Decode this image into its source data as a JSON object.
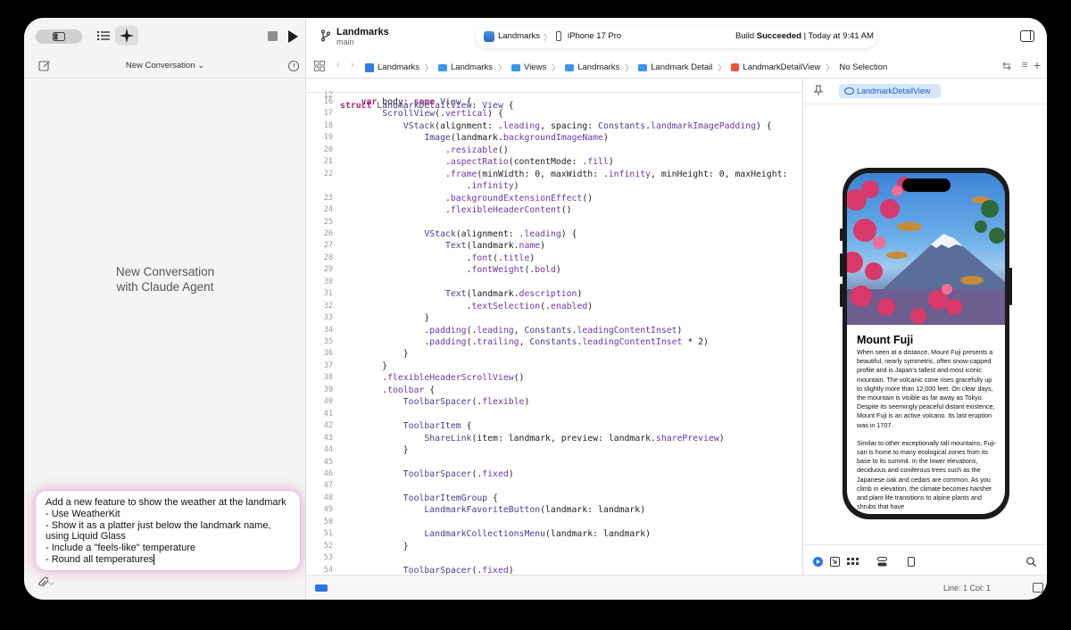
{
  "sidebar": {
    "conversation_title": "New Conversation",
    "empty_title": "New Conversation",
    "empty_subtitle": "with Claude Agent",
    "prompt_lines": [
      "Add a new feature to show the weather at the landmark",
      "- Use WeatherKit",
      "- Show it as a platter just below the landmark name,",
      "using Liquid Glass",
      "- Include a \"feels-like\" temperature",
      "- Round all temperatures"
    ],
    "attach_label": "⌵"
  },
  "toolbar": {
    "project_name": "Landmarks",
    "branch": "main",
    "scheme": "Landmarks",
    "scheme_sep": "〉",
    "device": "iPhone 17 Pro",
    "status_prefix": "Build ",
    "status_bold": "Succeeded",
    "status_suffix": " | Today at 9:41 AM"
  },
  "jumpbar": {
    "crumbs": [
      "Landmarks",
      "Landmarks",
      "Views",
      "Landmarks",
      "Landmark Detail",
      "LandmarkDetailView",
      "No Selection"
    ]
  },
  "editor": {
    "sticky": {
      "n": "12",
      "code": "struct LandmarkDetailView: View {"
    },
    "lines": [
      {
        "n": "16",
        "code": "    var body: some View {"
      },
      {
        "n": "17",
        "code": "        ScrollView(.vertical) {"
      },
      {
        "n": "18",
        "code": "            VStack(alignment: .leading, spacing: Constants.landmarkImagePadding) {"
      },
      {
        "n": "19",
        "code": "                Image(landmark.backgroundImageName)"
      },
      {
        "n": "20",
        "code": "                    .resizable()"
      },
      {
        "n": "21",
        "code": "                    .aspectRatio(contentMode: .fill)"
      },
      {
        "n": "22",
        "code": "                    .frame(minWidth: 0, maxWidth: .infinity, minHeight: 0, maxHeight:"
      },
      {
        "n": "",
        "code": "                        .infinity)"
      },
      {
        "n": "23",
        "code": "                    .backgroundExtensionEffect()"
      },
      {
        "n": "24",
        "code": "                    .flexibleHeaderContent()"
      },
      {
        "n": "25",
        "code": ""
      },
      {
        "n": "26",
        "code": "                VStack(alignment: .leading) {"
      },
      {
        "n": "27",
        "code": "                    Text(landmark.name)"
      },
      {
        "n": "28",
        "code": "                        .font(.title)"
      },
      {
        "n": "29",
        "code": "                        .fontWeight(.bold)"
      },
      {
        "n": "30",
        "code": ""
      },
      {
        "n": "31",
        "code": "                    Text(landmark.description)"
      },
      {
        "n": "32",
        "code": "                        .textSelection(.enabled)"
      },
      {
        "n": "33",
        "code": "                }"
      },
      {
        "n": "34",
        "code": "                .padding(.leading, Constants.leadingContentInset)"
      },
      {
        "n": "35",
        "code": "                .padding(.trailing, Constants.leadingContentInset * 2)"
      },
      {
        "n": "36",
        "code": "            }"
      },
      {
        "n": "37",
        "code": "        }"
      },
      {
        "n": "38",
        "code": "        .flexibleHeaderScrollView()"
      },
      {
        "n": "39",
        "code": "        .toolbar {"
      },
      {
        "n": "40",
        "code": "            ToolbarSpacer(.flexible)"
      },
      {
        "n": "41",
        "code": ""
      },
      {
        "n": "42",
        "code": "            ToolbarItem {"
      },
      {
        "n": "43",
        "code": "                ShareLink(item: landmark, preview: landmark.sharePreview)"
      },
      {
        "n": "44",
        "code": "            }"
      },
      {
        "n": "45",
        "code": ""
      },
      {
        "n": "46",
        "code": "            ToolbarSpacer(.fixed)"
      },
      {
        "n": "47",
        "code": ""
      },
      {
        "n": "48",
        "code": "            ToolbarItemGroup {"
      },
      {
        "n": "49",
        "code": "                LandmarkFavoriteButton(landmark: landmark)"
      },
      {
        "n": "50",
        "code": ""
      },
      {
        "n": "51",
        "code": "                LandmarkCollectionsMenu(landmark: landmark)"
      },
      {
        "n": "52",
        "code": "            }"
      },
      {
        "n": "53",
        "code": ""
      },
      {
        "n": "54",
        "code": "            ToolbarSpacer(.fixed)"
      }
    ]
  },
  "canvas": {
    "tab_label": "LandmarkDetailView",
    "preview_title": "Mount Fuji",
    "preview_paragraph1": "When seen at a distance, Mount Fuji presents a beautiful, nearly symmetric, often snow-capped profile and is Japan's tallest and most iconic mountain. The volcanic cone rises gracefully up to slightly more than 12,000 feet. On clear days, the mountain is visible as far away as Tokyo. Despite its seemingly peaceful distant existence, Mount Fuji is an active volcano. Its last eruption was in 1707.",
    "preview_paragraph2": "Similar to other exceptionally tall mountains, Fuji-san is home to many ecological zones from its base to its summit. In the lower elevations, deciduous and coniferous trees such as the Japanese oak and cedars are common. As you climb in elevation, the climate becomes harsher and plant life transitions to alpine plants and shrubs that have"
  },
  "statusbar": {
    "position": "Line: 1  Col: 1"
  },
  "colors": {
    "accent": "#2c74e6",
    "keyword": "#a3297a",
    "type": "#4b3b8f"
  }
}
